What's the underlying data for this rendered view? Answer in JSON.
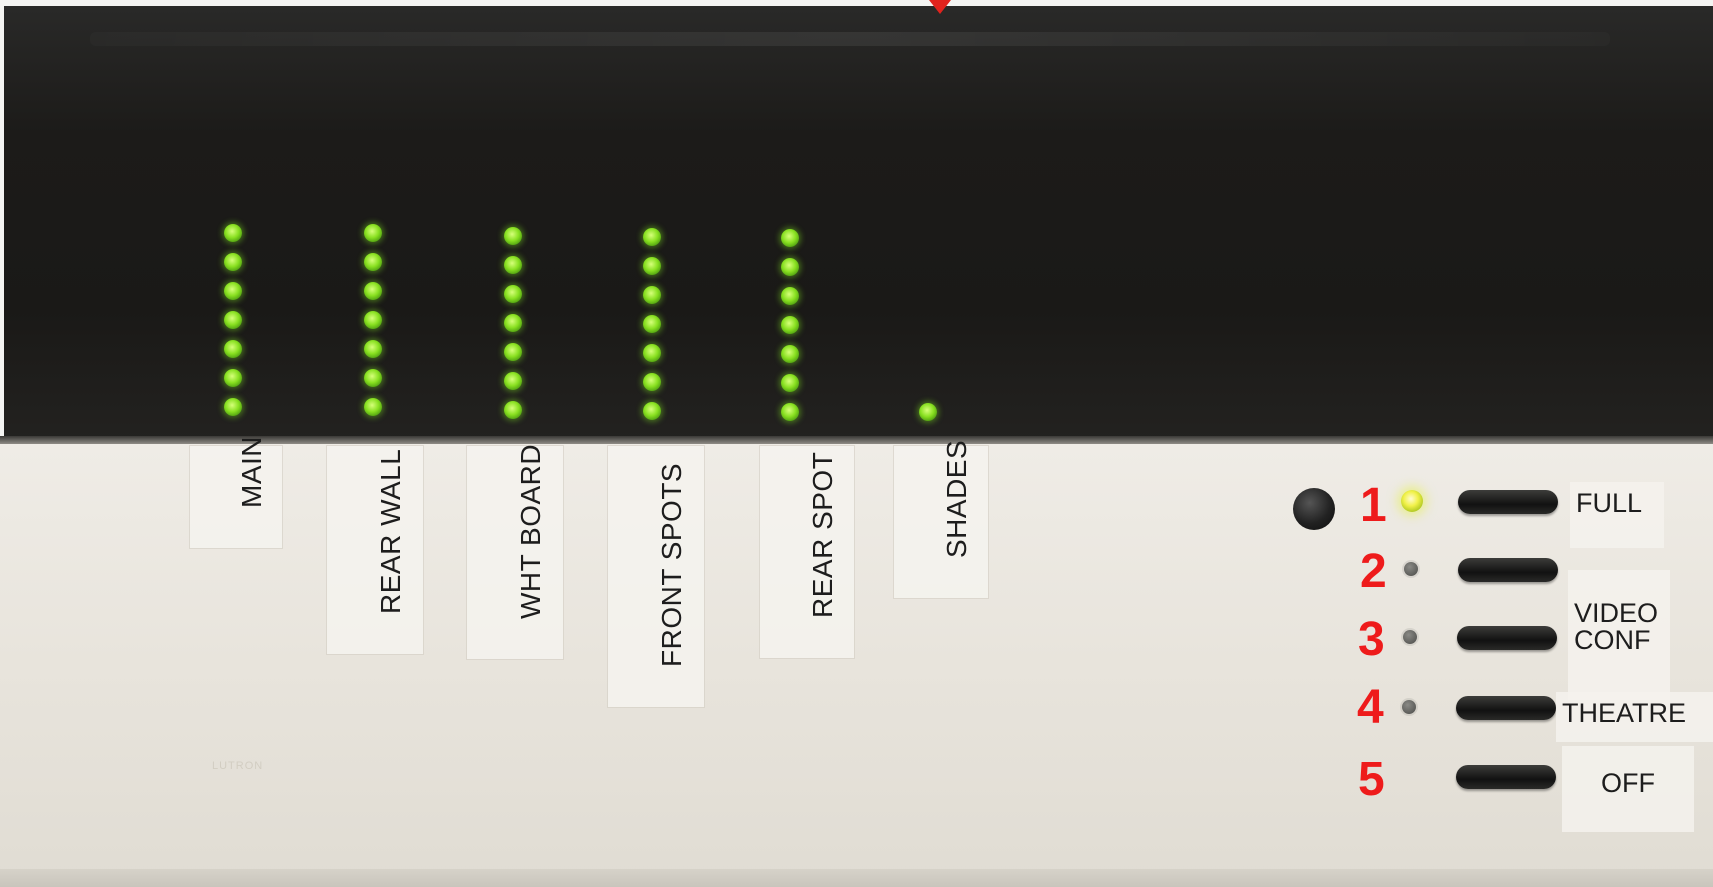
{
  "zones": [
    {
      "label": "MAIN",
      "led_count": 7
    },
    {
      "label": "REAR WALL",
      "led_count": 7
    },
    {
      "label": "WHT BOARD",
      "led_count": 7
    },
    {
      "label": "FRONT SPOTS",
      "led_count": 7
    },
    {
      "label": "REAR SPOT",
      "led_count": 7
    },
    {
      "label": "SHADES",
      "led_count": 1
    }
  ],
  "scenes": [
    {
      "number": "1",
      "label_lines": [
        "FULL"
      ],
      "active": true
    },
    {
      "number": "2",
      "label_lines": [],
      "active": false
    },
    {
      "number": "3",
      "label_lines": [
        "VIDEO",
        "CONF"
      ],
      "active": false
    },
    {
      "number": "4",
      "label_lines": [
        "THEATRE"
      ],
      "active": false
    },
    {
      "number": "5",
      "label_lines": [
        "OFF"
      ],
      "active": false
    }
  ],
  "brand": "LUTRON",
  "colors": {
    "led_on": "#88e020",
    "scene_led_on": "#f1f14a",
    "annotation": "#ee1b1b"
  }
}
